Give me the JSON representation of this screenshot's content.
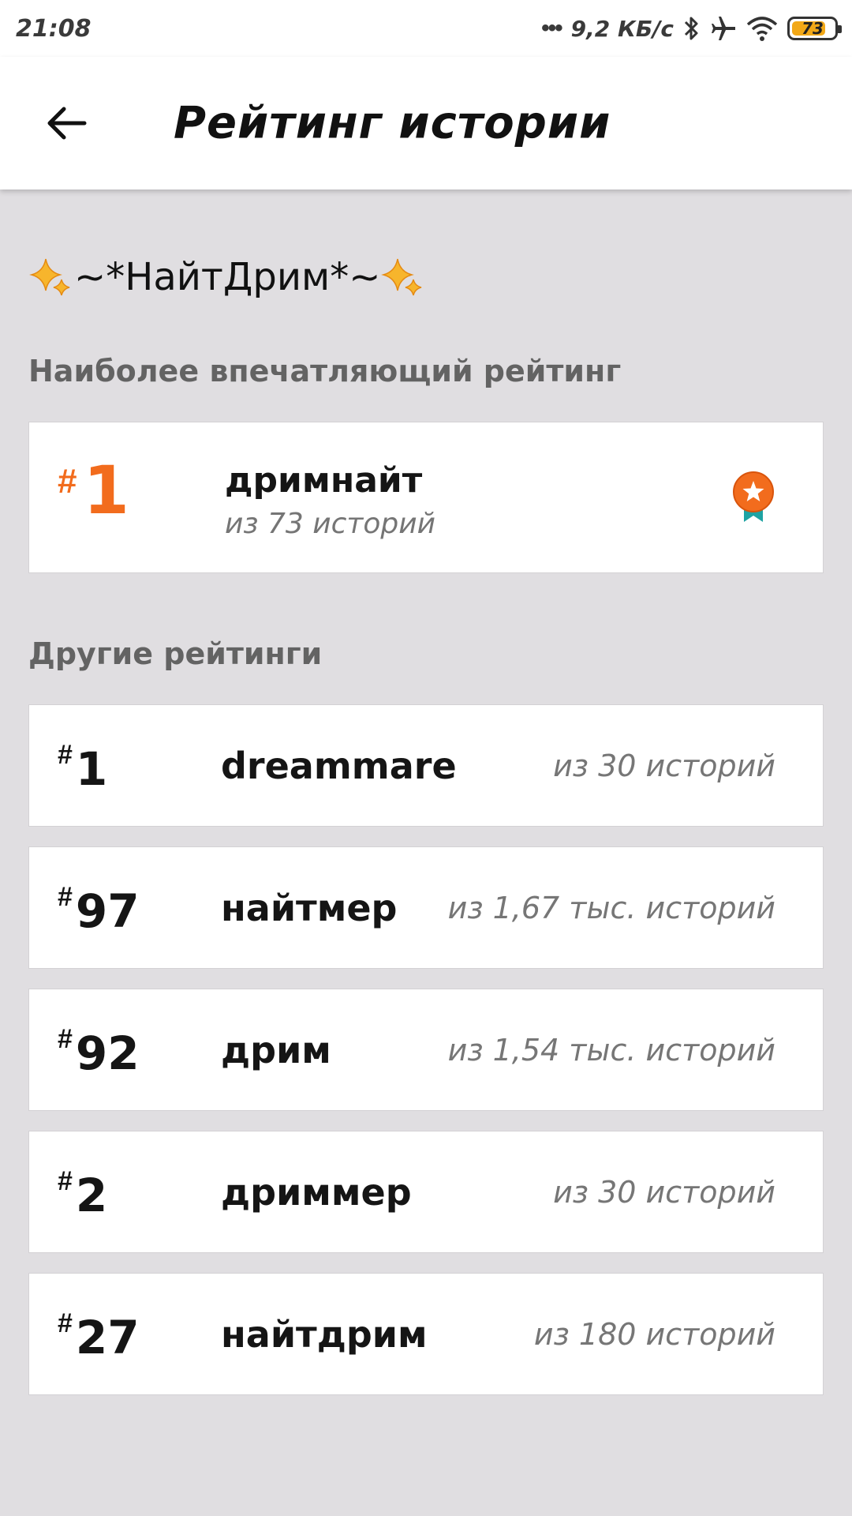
{
  "status_bar": {
    "time": "21:08",
    "dots": "•••",
    "network_speed": "9,2 КБ/с",
    "battery_level": "73",
    "battery_color": "#f2a817"
  },
  "app_bar": {
    "back_icon": "arrow-left-icon",
    "title": "Рейтинг истории"
  },
  "story": {
    "title": "~*НайтДрим*~",
    "decoration_icon": "sparkles-icon"
  },
  "top_ranking": {
    "section_label": "Наиболее впечатляющий рейтинг",
    "hash": "#",
    "rank": "1",
    "tag": "дримнайт",
    "subtitle": "из 73 историй",
    "badge_icon": "medal-star-icon",
    "accent_color": "#f26c1d"
  },
  "other_rankings": {
    "section_label": "Другие рейтинги",
    "items": [
      {
        "hash": "#",
        "rank": "1",
        "tag": "dreammare",
        "count": "из 30 историй"
      },
      {
        "hash": "#",
        "rank": "97",
        "tag": "найтмер",
        "count": "из 1,67 тыс. историй"
      },
      {
        "hash": "#",
        "rank": "92",
        "tag": "дрим",
        "count": "из 1,54 тыс. историй"
      },
      {
        "hash": "#",
        "rank": "2",
        "tag": "дриммер",
        "count": "из 30 историй"
      },
      {
        "hash": "#",
        "rank": "27",
        "tag": "найтдрим",
        "count": "из 180 историй"
      }
    ]
  }
}
